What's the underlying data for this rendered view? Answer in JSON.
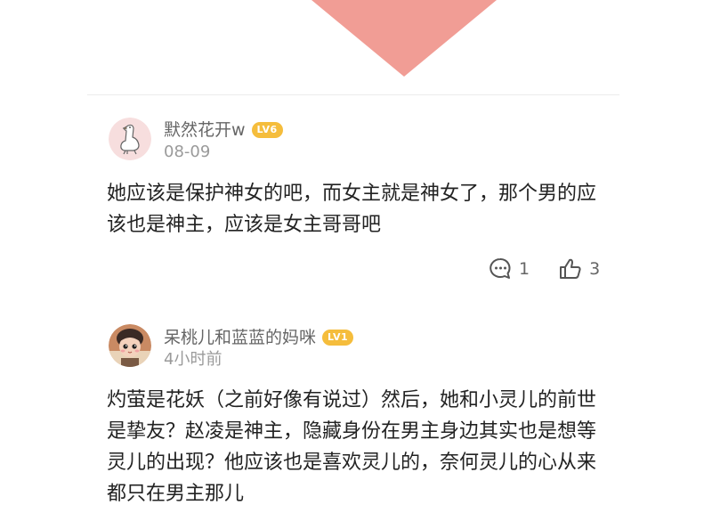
{
  "colors": {
    "accent_shape": "#f19d95",
    "level_badge": "#f5bd3c",
    "username": "#666666",
    "timestamp": "#9a9a9a",
    "body_text": "#222222"
  },
  "comments": [
    {
      "username": "默然花开w",
      "level": "LV6",
      "time": "08-09",
      "text": "她应该是保护神女的吧，而女主就是神女了，那个男的应该也是神主，应该是女主哥哥吧",
      "reply_icon": "comment-bubble-icon",
      "reply_count": "1",
      "like_icon": "thumbs-up-icon",
      "like_count": "3"
    },
    {
      "username": "呆桃儿和蓝蓝的妈咪",
      "level": "LV1",
      "time": "4小时前",
      "text": "灼萤是花妖（之前好像有说过）然后，她和小灵儿的前世是挚友？赵凌是神主，隐藏身份在男主身边其实也是想等灵儿的出现？他应该也是喜欢灵儿的，奈何灵儿的心从来都只在男主那儿"
    }
  ]
}
